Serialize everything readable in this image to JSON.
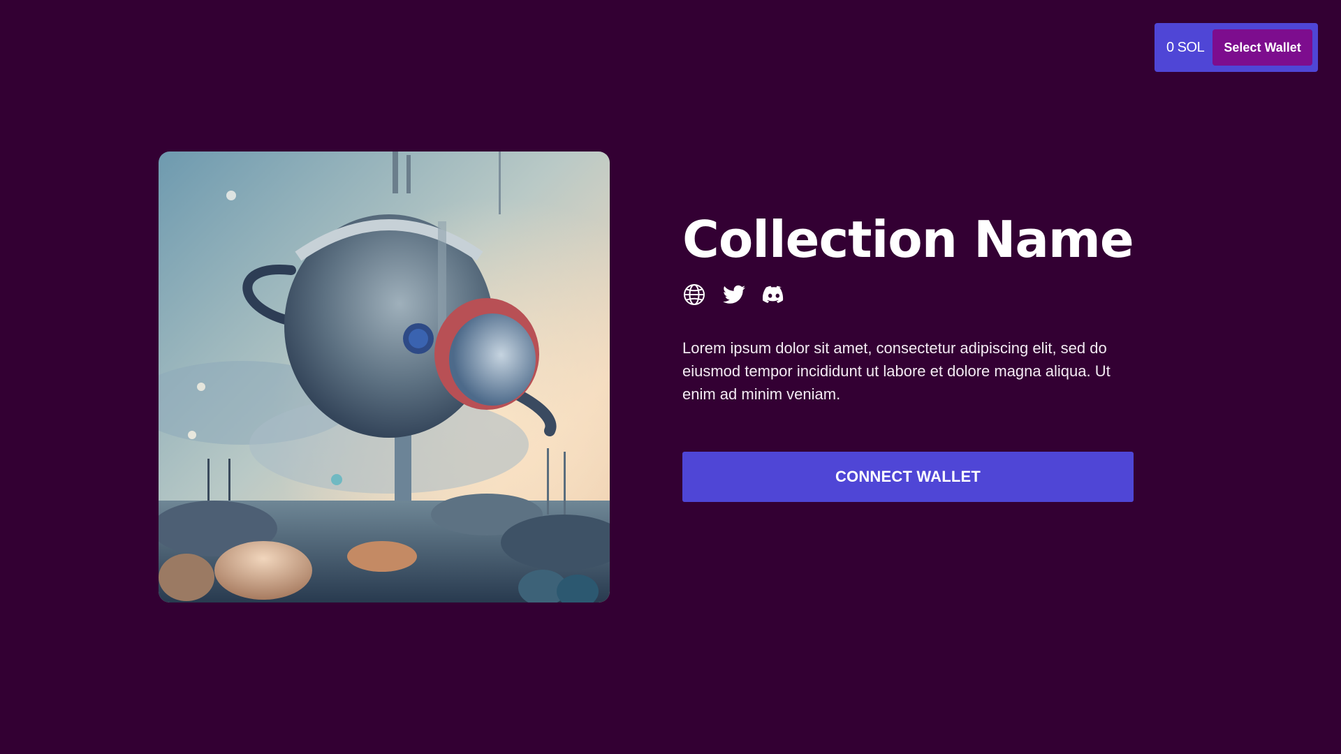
{
  "wallet": {
    "balance": "0 SOL",
    "select_label": "Select Wallet"
  },
  "collection": {
    "title": "Collection Name",
    "description": "Lorem ipsum dolor sit amet, consectetur adipiscing elit, sed do eiusmod tempor incididunt ut labore et dolore magna aliqua. Ut enim ad minim veniam.",
    "connect_label": "CONNECT WALLET"
  },
  "social_links": [
    "globe-icon",
    "twitter-icon",
    "discord-icon"
  ],
  "colors": {
    "background": "#330033",
    "accent": "#4f46d6",
    "select_wallet": "#7d0d8e",
    "text": "#ffffff"
  }
}
